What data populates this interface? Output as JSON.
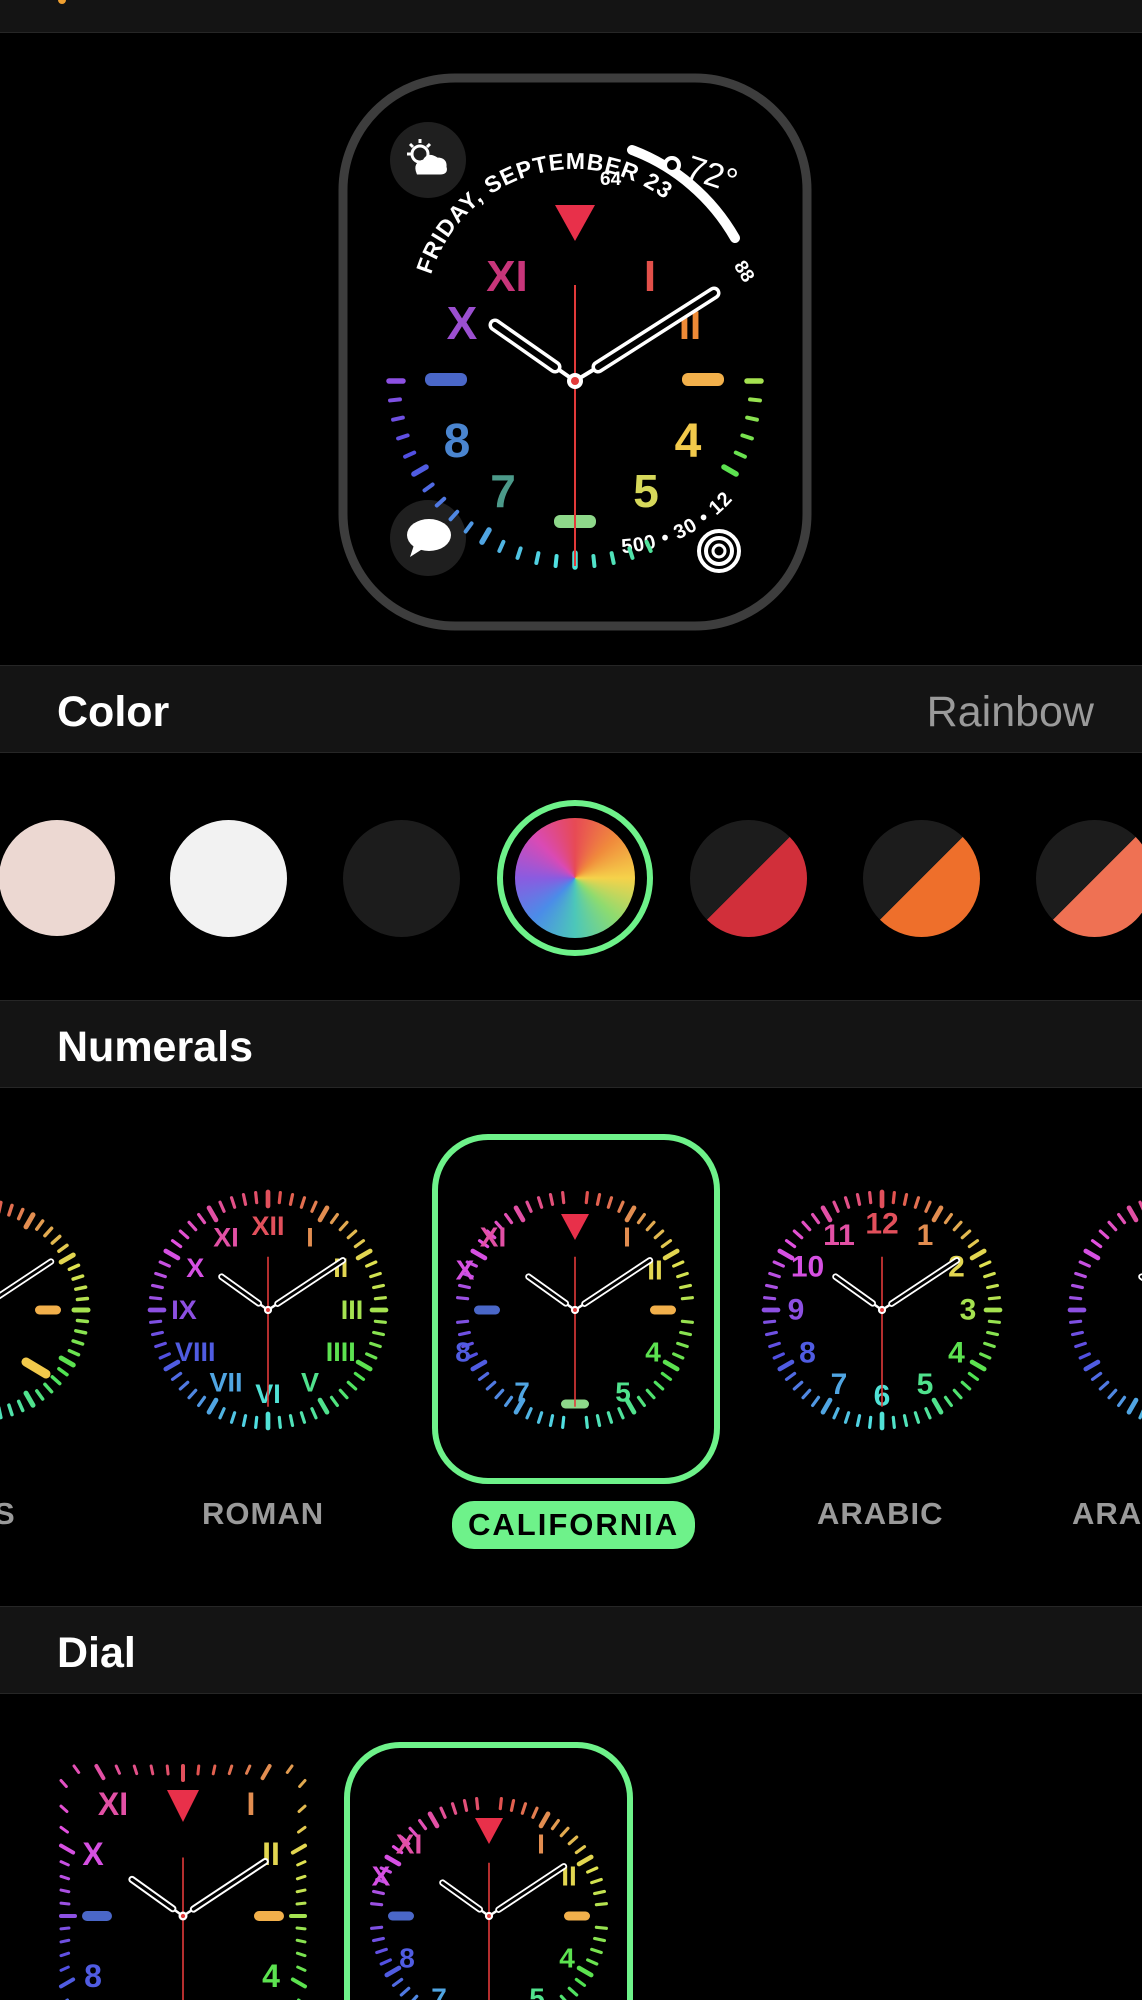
{
  "preview": {
    "date_text": "FRIDAY, SEPTEMBER 23",
    "temp_current": "72°",
    "temp_low": "64",
    "temp_high": "88",
    "activity_text": "500 • 30 • 12",
    "top_left_complication_icon": "weather-partly-sunny-icon",
    "bottom_left_complication_icon": "messages-bubble-icon",
    "bottom_right_complication_icon": "activity-rings-icon",
    "numerals": [
      "XI",
      "I",
      "X",
      "II",
      "8",
      "4",
      "7",
      "5"
    ]
  },
  "color_section": {
    "label": "Color",
    "value": "Rainbow",
    "swatches": [
      {
        "name": "swatch-blush",
        "color": "#ecd8d2"
      },
      {
        "name": "swatch-white",
        "color": "#f2f2f2"
      },
      {
        "name": "swatch-black",
        "color": "#1c1c1c"
      },
      {
        "name": "swatch-rainbow",
        "color": "rainbow",
        "selected": true
      },
      {
        "name": "swatch-red",
        "color": "#d12f3a"
      },
      {
        "name": "swatch-orange",
        "color": "#ee6f2b"
      },
      {
        "name": "swatch-coral",
        "color": "#ef7153"
      }
    ]
  },
  "numerals_section": {
    "label": "Numerals",
    "styles": [
      {
        "label": "S"
      },
      {
        "label": "ROMAN",
        "numerals": [
          "XII",
          "I",
          "II",
          "III",
          "IIII",
          "V",
          "VI",
          "VII",
          "VIII",
          "IX",
          "X",
          "XI"
        ]
      },
      {
        "label": "CALIFORNIA",
        "selected": true,
        "numerals": [
          "XI",
          "I",
          "X",
          "II",
          "8",
          "4",
          "7",
          "5"
        ]
      },
      {
        "label": "ARABIC",
        "numerals": [
          "12",
          "1",
          "2",
          "3",
          "4",
          "5",
          "6",
          "7",
          "8",
          "9",
          "10",
          "11"
        ]
      },
      {
        "label": "ARA"
      }
    ]
  },
  "dial_section": {
    "label": "Dial",
    "options": [
      {
        "name": "dial-fullscreen",
        "numerals": [
          "XI",
          "I",
          "X",
          "II",
          "8",
          "4"
        ]
      },
      {
        "name": "dial-circular",
        "selected": true,
        "numerals": [
          "XI",
          "I",
          "X",
          "II",
          "8",
          "4",
          "7",
          "5"
        ]
      }
    ]
  },
  "colors": {
    "accent_green": "#6ef28a",
    "header_bg": "#141414",
    "secondary_text": "#9a9a9a"
  }
}
